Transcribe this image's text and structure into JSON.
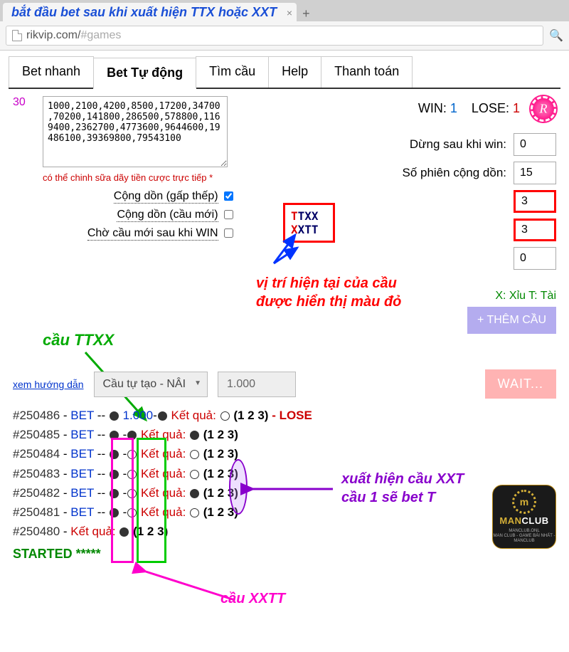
{
  "browser": {
    "tab_title": "bắt đầu bet sau khi xuất hiện TTX hoặc XXT",
    "url_domain": "rikvip.com/",
    "url_hash": "#games"
  },
  "tabs": [
    "Bet nhanh",
    "Bet Tự động",
    "Tìm cầu",
    "Help",
    "Thanh toán"
  ],
  "active_tab": 1,
  "counter": "30",
  "bet_series": "1000,2100,4200,8500,17200,34700,70200,141800,286500,578800,1169400,2362700,4773600,9644600,19486100,39369800,79543100",
  "edit_note": "có thể chinh sữa dãy tiền cược trực tiếp *",
  "checkboxes": {
    "gap_thep": {
      "label": "Cộng dồn (gấp thếp)",
      "checked": true
    },
    "cau_moi": {
      "label": "Cộng dồn (cầu mới)",
      "checked": false
    },
    "cho_cau": {
      "label": "Chờ cầu mới sau khi WIN",
      "checked": false
    }
  },
  "stats": {
    "win_label": "WIN:",
    "win": "1",
    "lose_label": "LOSE:",
    "lose": "1"
  },
  "fields": {
    "dung_win": {
      "label": "Dừng sau khi win:",
      "value": "0"
    },
    "cong_don": {
      "label": "Số phiên cộng dồn:",
      "value": "15"
    },
    "box1": "3",
    "box2": "3",
    "box3": "0"
  },
  "patterns": {
    "p1": "TTXX",
    "p2": "XXTT"
  },
  "legend": "X: Xỉu T: Tài",
  "btn_add": "+ THÊM CẦU",
  "annotations": {
    "cau_ttxx": "cầu TTXX",
    "vitri1": "vị trí hiện tại của cầu",
    "vitri2": "được hiển thị màu đỏ",
    "xuat1": "xuất hiện cầu XXT",
    "xuat2": "cầu 1 sẽ bet T",
    "cau_xxtt": "cầu XXTT"
  },
  "controls": {
    "guide": "xem hướng dẫn",
    "select": "Cầu tự tạo - NÂI",
    "amount": "1.000",
    "wait": "WAIT..."
  },
  "results": [
    {
      "id": "#250486",
      "bet": "BET",
      "amt": "1.000",
      "d1": "f",
      "d2": "f",
      "kq": "Kết quả:",
      "r": "e",
      "seq": "(1 2 3)",
      "extra": " - LOSE"
    },
    {
      "id": "#250485",
      "bet": "BET",
      "d1": "f",
      "d2": "f",
      "kq": "Kết quả:",
      "r": "f",
      "seq": "(1 2 3)"
    },
    {
      "id": "#250484",
      "bet": "BET",
      "d1": "f",
      "d2": "e",
      "kq": "Kết quả:",
      "r": "e",
      "seq": "(1 2 3)"
    },
    {
      "id": "#250483",
      "bet": "BET",
      "d1": "f",
      "d2": "e",
      "kq": "Kết quả:",
      "r": "e",
      "seq": "(1 2 3)"
    },
    {
      "id": "#250482",
      "bet": "BET",
      "d1": "f",
      "d2": "e",
      "kq": "Kết quả:",
      "r": "f",
      "seq": "(1 2 3)"
    },
    {
      "id": "#250481",
      "bet": "BET",
      "d1": "f",
      "d2": "e",
      "kq": "Kết quả:",
      "r": "e",
      "seq": "(1 2 3)"
    },
    {
      "id": "#250480",
      "nobet": true,
      "kq": "Kết quả:",
      "r": "f",
      "seq": "(1 2 3)"
    }
  ],
  "started": "STARTED *****",
  "logo": {
    "brand1": "MAN",
    "brand2": "CLUB",
    "sub1": "MANCLUB.ONL",
    "sub2": "MAN CLUB - GAME BÀI NHẤT - MANCLUB"
  }
}
